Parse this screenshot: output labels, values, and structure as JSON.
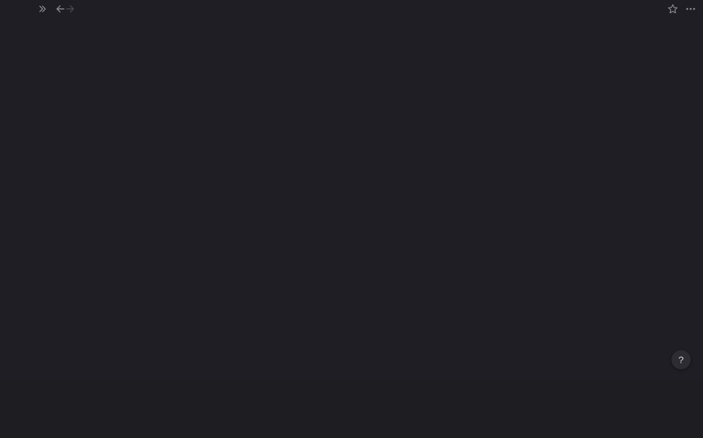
{
  "topbar": {
    "left_icons": [
      "chevrons-right-icon",
      "arrow-left-icon",
      "arrow-right-icon"
    ],
    "right_icons": [
      "star-icon",
      "more-horizontal-icon"
    ]
  },
  "help": {
    "label": "?"
  },
  "colors": {
    "background": "#1f1e24",
    "icon": "#8f8e94",
    "icon_disabled": "#4a4950",
    "help_bg": "#2d2c33"
  }
}
